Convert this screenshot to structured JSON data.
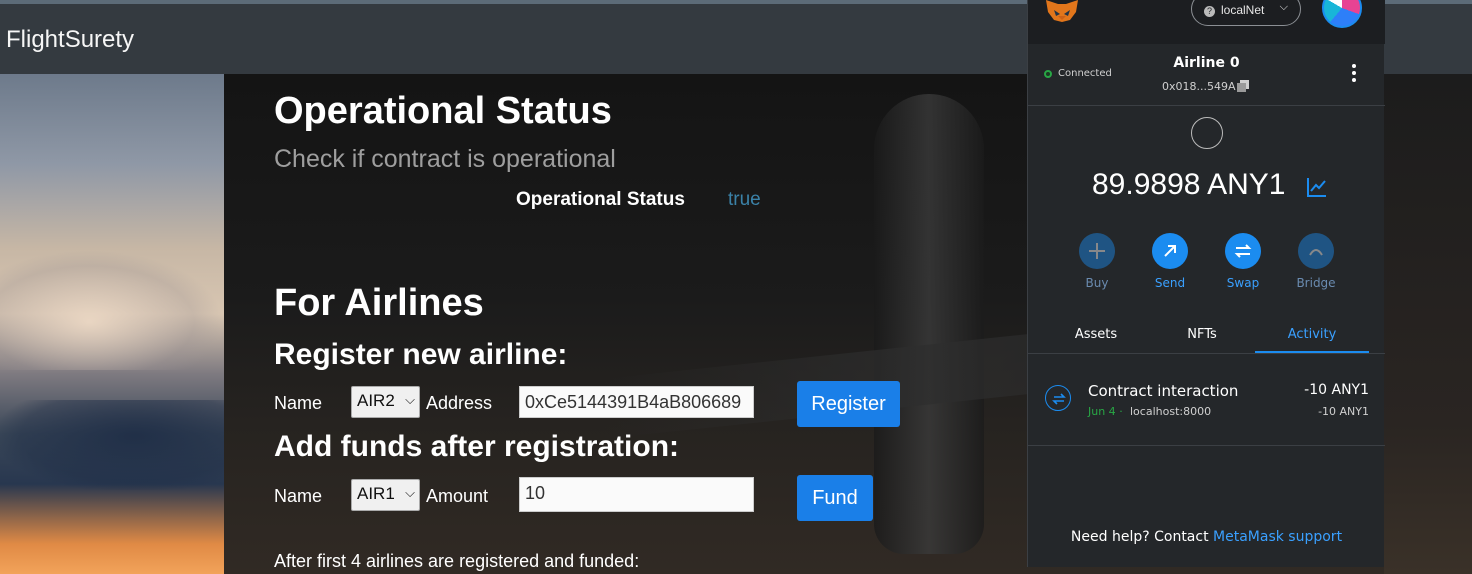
{
  "app": {
    "brand": "FlightSurety"
  },
  "operational": {
    "title": "Operational Status",
    "subtitle": "Check if contract is operational",
    "status_label": "Operational Status",
    "status_value": "true"
  },
  "airlines": {
    "title": "For Airlines",
    "register": {
      "heading": "Register new airline:",
      "name_label": "Name",
      "name_selected": "AIR2",
      "address_label": "Address",
      "address_value": "0xCe5144391B4aB806689",
      "button": "Register"
    },
    "fund": {
      "heading": "Add funds after registration:",
      "name_label": "Name",
      "name_selected": "AIR1",
      "amount_label": "Amount",
      "amount_value": "10",
      "button": "Fund"
    },
    "footer_note": "After first 4 airlines are registered and funded:"
  },
  "metamask": {
    "network": "localNet",
    "connection": "Connected",
    "account_name": "Airline 0",
    "account_address": "0x018...549A",
    "balance": "89.9898 ANY1",
    "actions": [
      {
        "label": "Buy",
        "enabled": false
      },
      {
        "label": "Send",
        "enabled": true
      },
      {
        "label": "Swap",
        "enabled": true
      },
      {
        "label": "Bridge",
        "enabled": false
      }
    ],
    "tabs": [
      "Assets",
      "NFTs",
      "Activity"
    ],
    "active_tab": "Activity",
    "activity": [
      {
        "title": "Contract interaction",
        "date": "Jun 4",
        "separator": "·",
        "origin": "localhost:8000",
        "amount": "-10 ANY1",
        "amount_secondary": "-10 ANY1"
      }
    ],
    "help_text": "Need help? Contact",
    "help_link": "MetaMask support",
    "colors": {
      "accent": "#1b8cf0",
      "connected": "#28a745",
      "panel": "#24272a"
    }
  }
}
